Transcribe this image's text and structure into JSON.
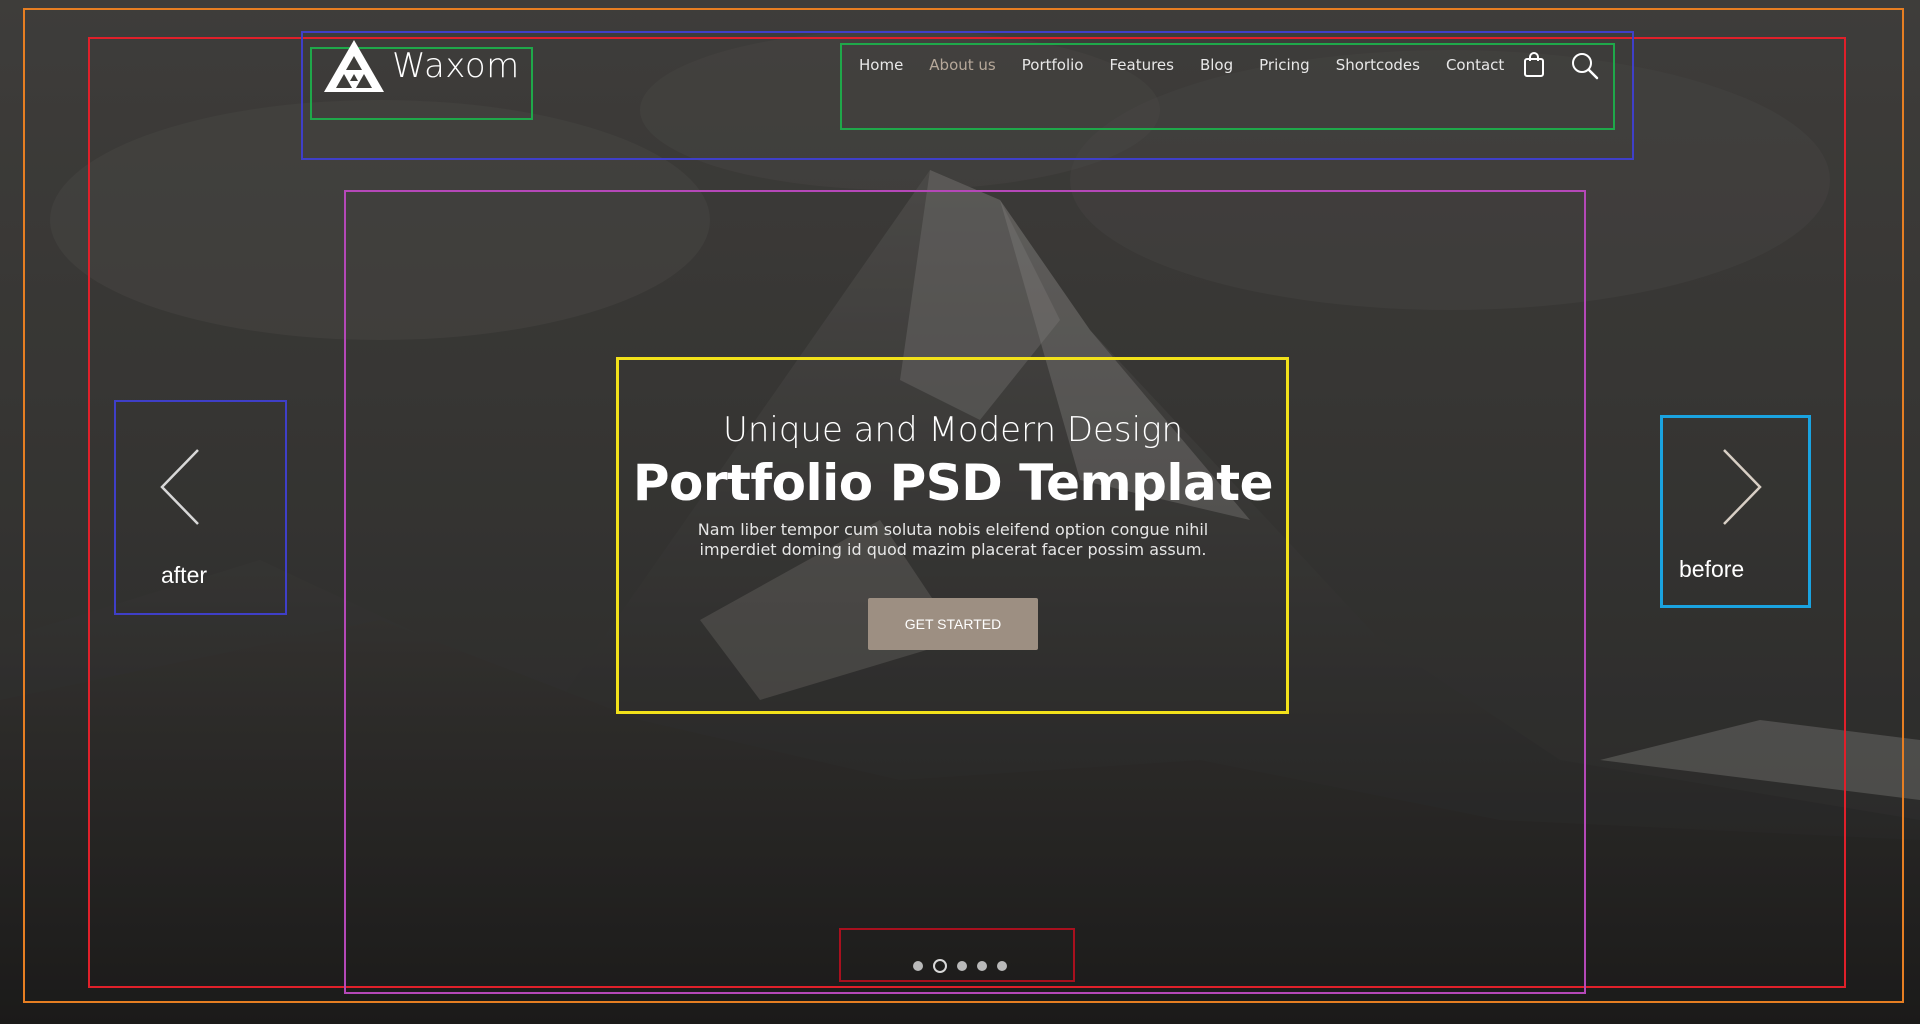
{
  "brand": {
    "name": "Waxom"
  },
  "nav": {
    "items": [
      {
        "label": "Home",
        "active": false
      },
      {
        "label": "About us",
        "active": true
      },
      {
        "label": "Portfolio",
        "active": false
      },
      {
        "label": "Features",
        "active": false
      },
      {
        "label": "Blog",
        "active": false
      },
      {
        "label": "Pricing",
        "active": false
      },
      {
        "label": "Shortcodes",
        "active": false
      },
      {
        "label": "Contact",
        "active": false
      }
    ],
    "icons": [
      "shopping-bag-icon",
      "search-icon"
    ]
  },
  "hero": {
    "subtitle": "Unique and Modern Design",
    "title": "Portfolio PSD Template",
    "text": "Nam liber tempor cum soluta nobis eleifend option congue nihil imperdiet doming id quod mazim placerat facer possim assum.",
    "cta": "GET STARTED"
  },
  "slider": {
    "prev_label": "after",
    "next_label": "before",
    "slide_count": 5,
    "active_slide": 2
  },
  "colors": {
    "accent": "#9d8f82",
    "nav_active": "#b6a89a",
    "outline_orange": "#e67e22",
    "outline_red": "#e0202a",
    "outline_blue": "#3f3fc8",
    "outline_green": "#1fa84a",
    "outline_purple": "#b548b8",
    "outline_yellow": "#f2e11a",
    "outline_cyan": "#1aa3e0",
    "outline_darkred": "#a8101e"
  }
}
